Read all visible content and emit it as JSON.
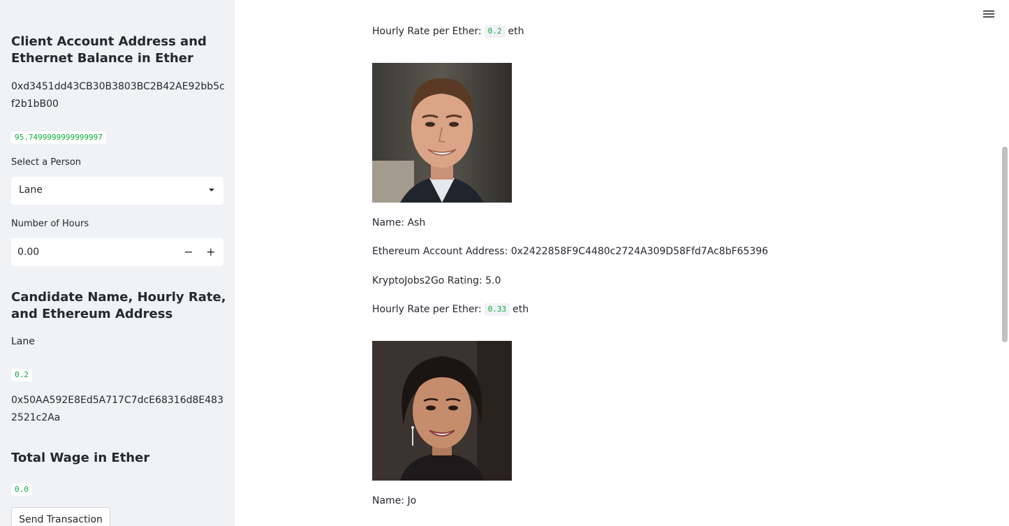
{
  "sidebar": {
    "client_heading": "Client Account Address and Ethernet Balance in Ether",
    "client_address": "0xd3451dd43CB30B3803BC2B42AE92bb5cf2b1bB00",
    "client_balance": "95.7499999999999997",
    "select_label": "Select a Person",
    "select_value": "Lane",
    "hours_label": "Number of Hours",
    "hours_value": "0.00",
    "minus_label": "−",
    "plus_label": "+",
    "candidate_heading": "Candidate Name, Hourly Rate, and Ethereum Address",
    "candidate_name": "Lane",
    "candidate_rate": "0.2",
    "candidate_address": "0x50AA592E8Ed5A717C7dcE68316d8E4832521c2Aa",
    "wage_heading": "Total Wage in Ether",
    "wage_value": "0.0",
    "send_button": "Send Transaction"
  },
  "main": {
    "top_rate_label": "Hourly Rate per Ether:",
    "top_rate_value": "0.2",
    "top_rate_unit": "eth",
    "candidates": [
      {
        "name_line": "Name: Ash",
        "address_line": "Ethereum Account Address: 0x2422858F9C4480c2724A309D58Ffd7Ac8bF65396",
        "rating_line": "KryptoJobs2Go Rating: 5.0",
        "rate_label": "Hourly Rate per Ether:",
        "rate_value": "0.33",
        "rate_unit": "eth"
      },
      {
        "name_line": "Name: Jo"
      }
    ]
  },
  "icons": {
    "menu": "hamburger-menu-icon",
    "select_caret": "caret-down-icon"
  },
  "colors": {
    "sidebar_bg": "#f0f2f6",
    "code_green": "#09ab3b",
    "text": "#262730"
  }
}
